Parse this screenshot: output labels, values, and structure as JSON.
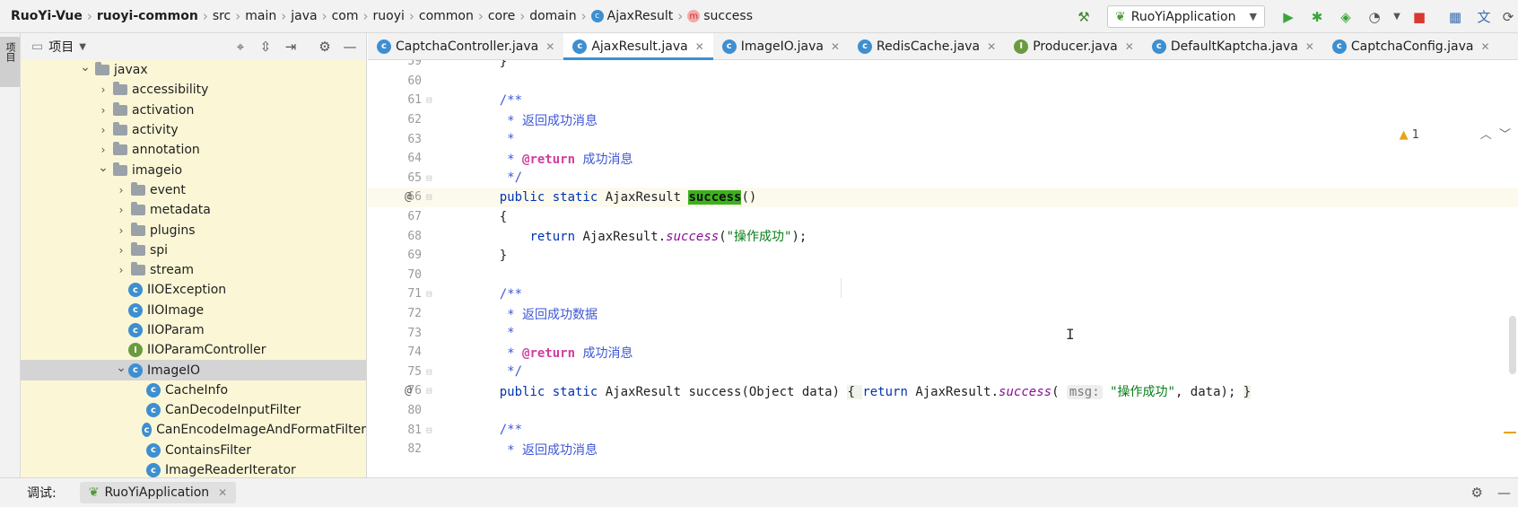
{
  "breadcrumb": [
    {
      "label": "RuoYi-Vue",
      "bold": true
    },
    {
      "label": "ruoyi-common",
      "bold": true
    },
    {
      "label": "src"
    },
    {
      "label": "main"
    },
    {
      "label": "java"
    },
    {
      "label": "com"
    },
    {
      "label": "ruoyi"
    },
    {
      "label": "common"
    },
    {
      "label": "core"
    },
    {
      "label": "domain"
    },
    {
      "label": "AjaxResult",
      "icon": "class-icon"
    },
    {
      "label": "success",
      "icon": "method-icon"
    }
  ],
  "toolbar": {
    "run_config": "RuoYiApplication"
  },
  "left_strip": {
    "tab_label": "项目"
  },
  "project_panel": {
    "title": "项目",
    "tree": [
      {
        "label": "javax",
        "type": "folder",
        "level": 0,
        "expanded": true
      },
      {
        "label": "accessibility",
        "type": "folder",
        "level": 1,
        "expanded": false
      },
      {
        "label": "activation",
        "type": "folder",
        "level": 1,
        "expanded": false
      },
      {
        "label": "activity",
        "type": "folder",
        "level": 1,
        "expanded": false
      },
      {
        "label": "annotation",
        "type": "folder",
        "level": 1,
        "expanded": false
      },
      {
        "label": "imageio",
        "type": "folder",
        "level": 1,
        "expanded": true
      },
      {
        "label": "event",
        "type": "folder",
        "level": 2,
        "expanded": false
      },
      {
        "label": "metadata",
        "type": "folder",
        "level": 2,
        "expanded": false
      },
      {
        "label": "plugins",
        "type": "folder",
        "level": 2,
        "expanded": false
      },
      {
        "label": "spi",
        "type": "folder",
        "level": 2,
        "expanded": false
      },
      {
        "label": "stream",
        "type": "folder",
        "level": 2,
        "expanded": false
      },
      {
        "label": "IIOException",
        "type": "class",
        "level": 2
      },
      {
        "label": "IIOImage",
        "type": "class",
        "level": 2
      },
      {
        "label": "IIOParam",
        "type": "class",
        "level": 2
      },
      {
        "label": "IIOParamController",
        "type": "interface",
        "level": 2
      },
      {
        "label": "ImageIO",
        "type": "class",
        "level": 2,
        "expanded": true,
        "selected": true
      },
      {
        "label": "CacheInfo",
        "type": "class",
        "level": 3
      },
      {
        "label": "CanDecodeInputFilter",
        "type": "class",
        "level": 3
      },
      {
        "label": "CanEncodeImageAndFormatFilter",
        "type": "class",
        "level": 3
      },
      {
        "label": "ContainsFilter",
        "type": "class",
        "level": 3
      },
      {
        "label": "ImageReaderIterator",
        "type": "class",
        "level": 3
      }
    ]
  },
  "editor_tabs": [
    {
      "label": "CaptchaController.java",
      "icon": "class-icon",
      "active": false
    },
    {
      "label": "AjaxResult.java",
      "icon": "class-icon",
      "active": true
    },
    {
      "label": "ImageIO.java",
      "icon": "class-icon",
      "active": false
    },
    {
      "label": "RedisCache.java",
      "icon": "class-icon",
      "active": false
    },
    {
      "label": "Producer.java",
      "icon": "interface-icon",
      "active": false
    },
    {
      "label": "DefaultKaptcha.java",
      "icon": "class-icon",
      "active": false
    },
    {
      "label": "CaptchaConfig.java",
      "icon": "class-icon",
      "active": false
    }
  ],
  "editor": {
    "warning_count": "1",
    "lines": [
      {
        "n": "59",
        "segs": [
          [
            "    }",
            "plain"
          ]
        ]
      },
      {
        "n": "60",
        "segs": []
      },
      {
        "n": "61",
        "segs": [
          [
            "    /**",
            "cm"
          ]
        ]
      },
      {
        "n": "62",
        "segs": [
          [
            "     * 返回成功消息",
            "cm"
          ]
        ]
      },
      {
        "n": "63",
        "segs": [
          [
            "     *",
            "cm"
          ]
        ]
      },
      {
        "n": "64",
        "segs": [
          [
            "     * ",
            "cm"
          ],
          [
            "@return",
            "cm-tag"
          ],
          [
            " 成功消息",
            "cm"
          ]
        ]
      },
      {
        "n": "65",
        "segs": [
          [
            "     */",
            "cm"
          ]
        ]
      },
      {
        "n": "66",
        "mark": "@",
        "current": true,
        "segs": [
          [
            "    ",
            "plain"
          ],
          [
            "public static",
            "kw"
          ],
          [
            " AjaxResult ",
            "plain"
          ],
          [
            "success",
            "hl"
          ],
          [
            "()",
            "plain"
          ]
        ]
      },
      {
        "n": "67",
        "segs": [
          [
            "    {",
            "plain"
          ]
        ]
      },
      {
        "n": "68",
        "segs": [
          [
            "        ",
            "plain"
          ],
          [
            "return",
            "kw"
          ],
          [
            " AjaxResult.",
            "plain"
          ],
          [
            "success",
            "ital"
          ],
          [
            "(",
            "plain"
          ],
          [
            "\"操作成功\"",
            "str"
          ],
          [
            ");",
            "plain"
          ]
        ]
      },
      {
        "n": "69",
        "segs": [
          [
            "    }",
            "plain"
          ]
        ]
      },
      {
        "n": "70",
        "segs": []
      },
      {
        "n": "71",
        "segs": [
          [
            "    /**",
            "cm"
          ]
        ]
      },
      {
        "n": "72",
        "segs": [
          [
            "     * 返回成功数据",
            "cm"
          ]
        ]
      },
      {
        "n": "73",
        "segs": [
          [
            "     *",
            "cm"
          ]
        ]
      },
      {
        "n": "74",
        "segs": [
          [
            "     * ",
            "cm"
          ],
          [
            "@return",
            "cm-tag"
          ],
          [
            " 成功消息",
            "cm"
          ]
        ]
      },
      {
        "n": "75",
        "segs": [
          [
            "     */",
            "cm"
          ]
        ]
      },
      {
        "n": "76",
        "mark": "@",
        "segs": [
          [
            "    ",
            "plain"
          ],
          [
            "public static",
            "kw"
          ],
          [
            " AjaxResult success(Object data) ",
            "plain"
          ],
          [
            "{ ",
            "fold-box"
          ],
          [
            "return",
            "kw"
          ],
          [
            " AjaxResult.",
            "plain"
          ],
          [
            "success",
            "ital"
          ],
          [
            "( ",
            "plain"
          ],
          [
            "msg:",
            "hint"
          ],
          [
            " ",
            "plain"
          ],
          [
            "\"操作成功\"",
            "str"
          ],
          [
            ", data); ",
            "plain"
          ],
          [
            "}",
            "fold-box"
          ]
        ]
      },
      {
        "n": "80",
        "segs": []
      },
      {
        "n": "81",
        "segs": [
          [
            "    /**",
            "cm"
          ]
        ]
      },
      {
        "n": "82",
        "segs": [
          [
            "     * 返回成功消息",
            "cm"
          ]
        ]
      }
    ]
  },
  "bottom": {
    "debug_label": "调试:",
    "debug_tab": "RuoYiApplication"
  }
}
